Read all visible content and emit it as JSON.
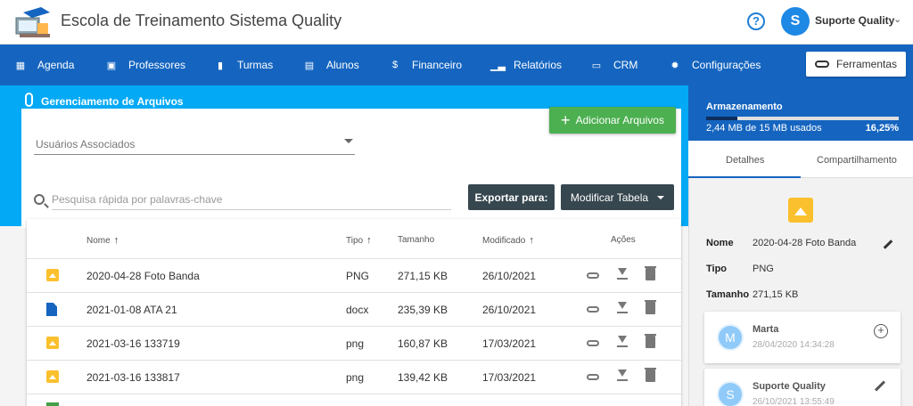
{
  "app": {
    "title": "Escola de Treinamento Sistema Quality"
  },
  "user": {
    "initial": "S",
    "name": "Suporte Quality"
  },
  "nav": {
    "items": [
      {
        "label": "Agenda",
        "icon": "calendar-icon"
      },
      {
        "label": "Professores",
        "icon": "person-card-icon"
      },
      {
        "label": "Turmas",
        "icon": "book-icon"
      },
      {
        "label": "Alunos",
        "icon": "contact-card-icon"
      },
      {
        "label": "Financeiro",
        "icon": "dollar-icon"
      },
      {
        "label": "Relatórios",
        "icon": "bar-chart-icon"
      },
      {
        "label": "CRM",
        "icon": "chat-icon"
      },
      {
        "label": "Configurações",
        "icon": "gear-icon"
      }
    ],
    "tools_label": "Ferramentas"
  },
  "files": {
    "section_title": "Gerenciamento de Arquivos",
    "add_label": "Adicionar Arquivos",
    "associated_users_label": "Usuários Associados",
    "search_placeholder": "Pesquisa rápida por palavras-chave",
    "export_label": "Exportar para:",
    "modify_label": "Modificar Tabela",
    "columns": {
      "name": "Nome",
      "type": "Tipo",
      "size": "Tamanho",
      "modified": "Modificado",
      "actions": "Ações"
    },
    "rows": [
      {
        "name": "2020-04-28 Foto Banda",
        "type": "PNG",
        "size": "271,15 KB",
        "modified": "26/10/2021",
        "icon": "image-file-icon"
      },
      {
        "name": "2021-01-08 ATA 21",
        "type": "docx",
        "size": "235,39 KB",
        "modified": "26/10/2021",
        "icon": "document-file-icon"
      },
      {
        "name": "2021-03-16 133719",
        "type": "png",
        "size": "160,87 KB",
        "modified": "17/03/2021",
        "icon": "image-file-icon"
      },
      {
        "name": "2021-03-16 133817",
        "type": "png",
        "size": "139,42 KB",
        "modified": "17/03/2021",
        "icon": "image-file-icon"
      }
    ]
  },
  "storage": {
    "title": "Armazenamento",
    "used_text": "2,44 MB de 15 MB usados",
    "percent_text": "16,25%",
    "fraction": 0.1625
  },
  "details": {
    "tabs": [
      "Detalhes",
      "Compartilhamento"
    ],
    "name_label": "Nome",
    "name_value": "2020-04-28 Foto Banda",
    "type_label": "Tipo",
    "type_value": "PNG",
    "size_label": "Tamanho",
    "size_value": "271,15 KB",
    "shares": [
      {
        "initial": "M",
        "name": "Marta",
        "date": "28/04/2020 14:34:28"
      },
      {
        "initial": "S",
        "name": "Suporte Quality",
        "date": "26/10/2021 13:55:49"
      }
    ]
  },
  "colors": {
    "nav_blue": "#1565c0",
    "band_blue": "#03a9f4",
    "add_green": "#4caf50",
    "dark_button": "#37474f",
    "image_yellow": "#fbc02d"
  }
}
